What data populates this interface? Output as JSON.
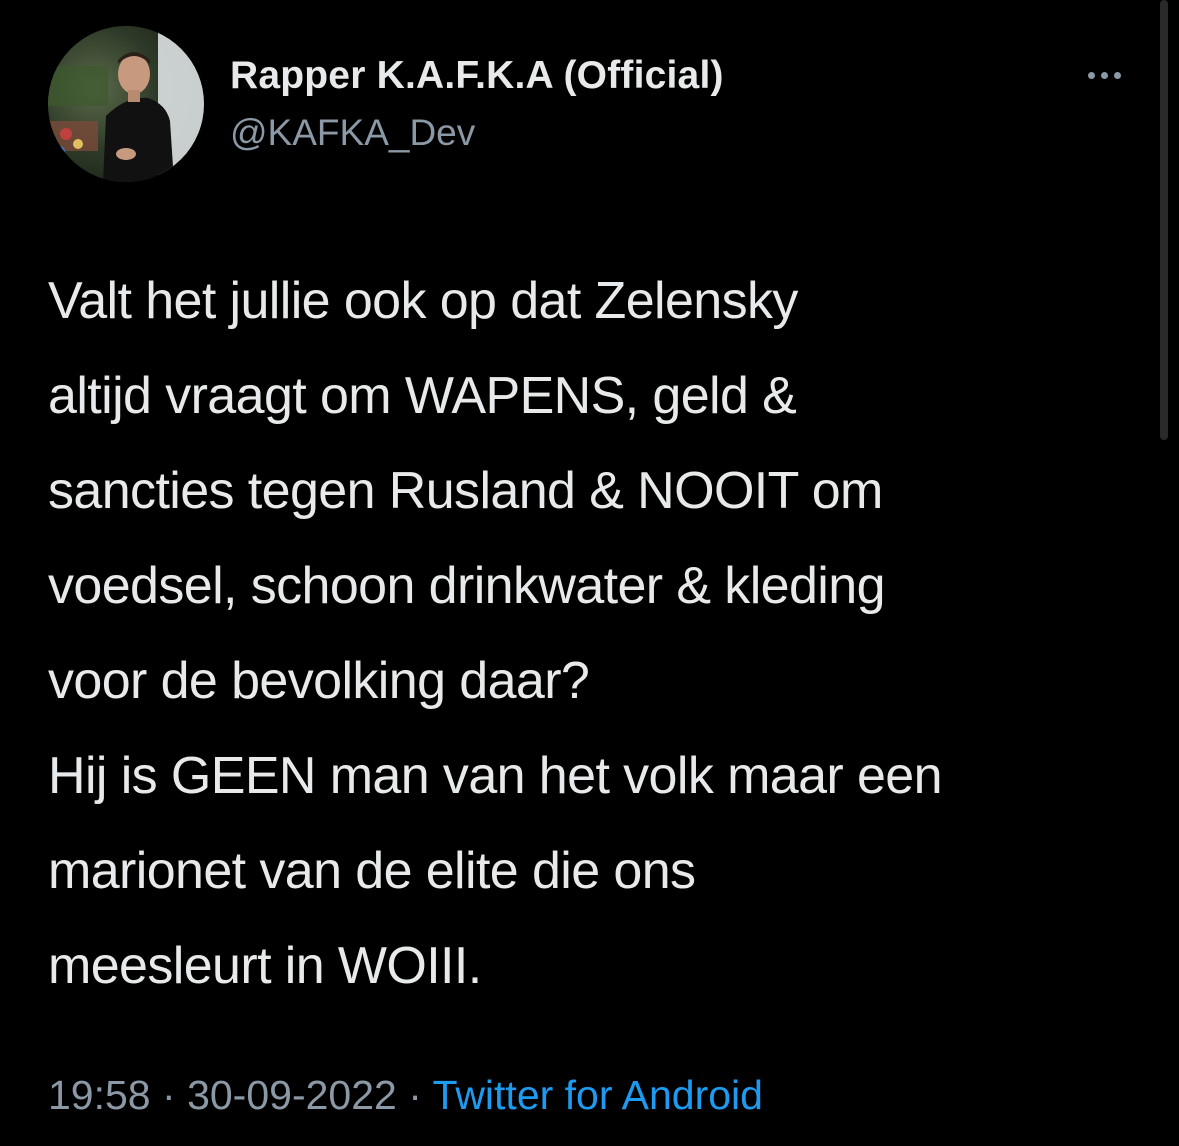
{
  "author": {
    "display_name": "Rapper K.A.F.K.A (Official)",
    "handle": "@KAFKA_Dev"
  },
  "tweet": {
    "lines": [
      "Valt het jullie ook op dat Zelensky",
      "altijd vraagt om WAPENS, geld &",
      "sancties tegen Rusland & NOOIT om",
      "voedsel, schoon drinkwater & kleding",
      "voor de bevolking daar?",
      "Hij is GEEN man van het volk maar een",
      "marionet van de elite die ons",
      "meesleurt in WOIII."
    ],
    "time": "19:58",
    "separator": "·",
    "date": "30-09-2022",
    "source": "Twitter for Android"
  },
  "icons": {
    "more": "more-horizontal-icon"
  },
  "colors": {
    "background": "#000000",
    "primary_text": "#e7e9ea",
    "secondary_text": "#8b98a5",
    "link": "#1d9bf0"
  }
}
